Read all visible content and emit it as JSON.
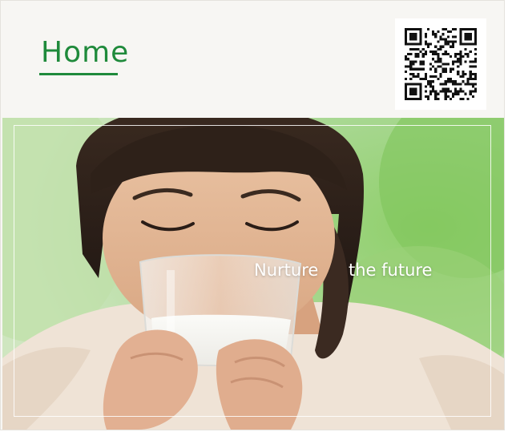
{
  "header": {
    "home_label": "Home",
    "qr_icon": "qr-code-icon"
  },
  "hero": {
    "image_icon": "girl-drinking-milk-photo",
    "tagline_part1": "Nurture",
    "tagline_part2": "the future"
  },
  "colors": {
    "brand_green": "#1f8a3b",
    "header_bg": "#f7f6f3",
    "tagline": "#ffffff"
  }
}
